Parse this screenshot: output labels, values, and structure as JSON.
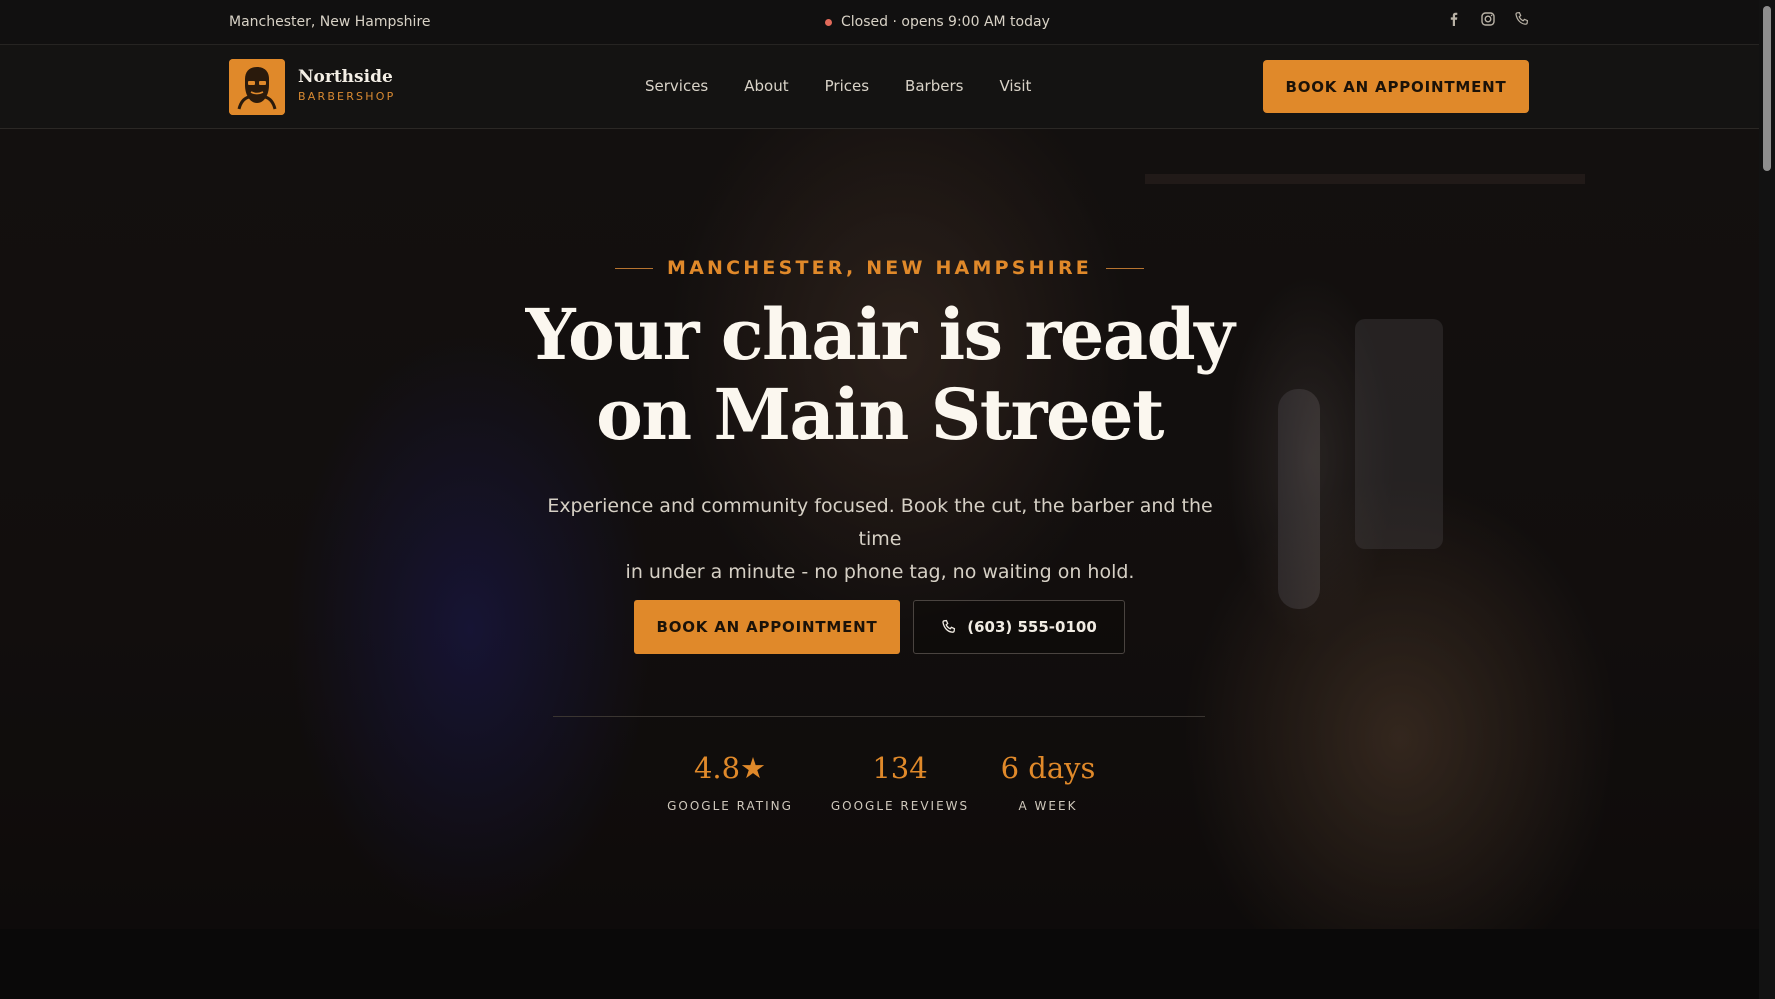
{
  "topbar": {
    "location": "Manchester, New Hampshire",
    "status": "Closed · opens 9:00 AM today",
    "social": [
      "facebook-icon",
      "instagram-icon",
      "phone-icon"
    ]
  },
  "nav": {
    "brand_name": "Northside",
    "brand_sub": "BARBERSHOP",
    "menu": [
      "Services",
      "About",
      "Prices",
      "Barbers",
      "Visit"
    ],
    "cta": "BOOK AN APPOINTMENT"
  },
  "hero": {
    "eyebrow": "MANCHESTER, NEW HAMPSHIRE",
    "headline_line1": "Your chair is ready",
    "headline_line2": "on Main Street",
    "lead_line1": "Experience and community focused. Book the cut, the barber and the time",
    "lead_line2": "in under a minute - no phone tag, no waiting on hold.",
    "cta": "BOOK AN APPOINTMENT",
    "phone": "(603) 555-0100"
  },
  "stats": [
    {
      "value": "4.8★",
      "label": "GOOGLE RATING"
    },
    {
      "value": "134",
      "label": "GOOGLE REVIEWS"
    },
    {
      "value": "6 days",
      "label": "A WEEK"
    }
  ],
  "colors": {
    "accent": "#e0892a",
    "background": "#0d0c0b",
    "status_dot": "#e26a5a"
  }
}
